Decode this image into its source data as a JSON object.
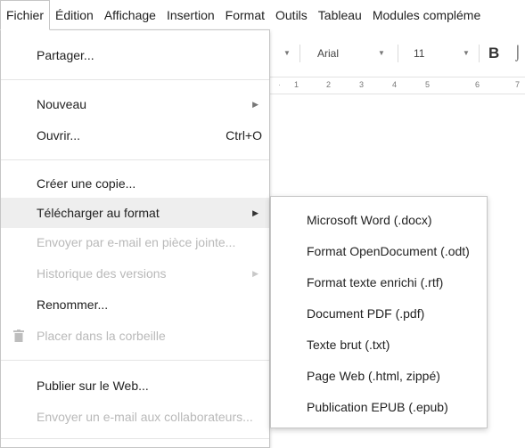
{
  "menubar": {
    "items": [
      "Fichier",
      "Édition",
      "Affichage",
      "Insertion",
      "Format",
      "Outils",
      "Tableau",
      "Modules compléme"
    ]
  },
  "toolbar": {
    "font": "Arial",
    "size": "11",
    "bold": "B"
  },
  "ruler": [
    "1",
    "2",
    "3",
    "4",
    "5",
    "6",
    "7"
  ],
  "file_menu": {
    "share": "Partager...",
    "new": "Nouveau",
    "open": "Ouvrir...",
    "open_shortcut": "Ctrl+O",
    "copy": "Créer une copie...",
    "download": "Télécharger au format",
    "email_attach": "Envoyer par e-mail en pièce jointe...",
    "history": "Historique des versions",
    "rename": "Renommer...",
    "trash": "Placer dans la corbeille",
    "publish": "Publier sur le Web...",
    "email_collab": "Envoyer un e-mail aux collaborateurs..."
  },
  "download_submenu": {
    "items": [
      "Microsoft Word (.docx)",
      "Format OpenDocument (.odt)",
      "Format texte enrichi (.rtf)",
      "Document PDF (.pdf)",
      "Texte brut (.txt)",
      "Page Web (.html, zippé)",
      "Publication EPUB (.epub)"
    ]
  }
}
